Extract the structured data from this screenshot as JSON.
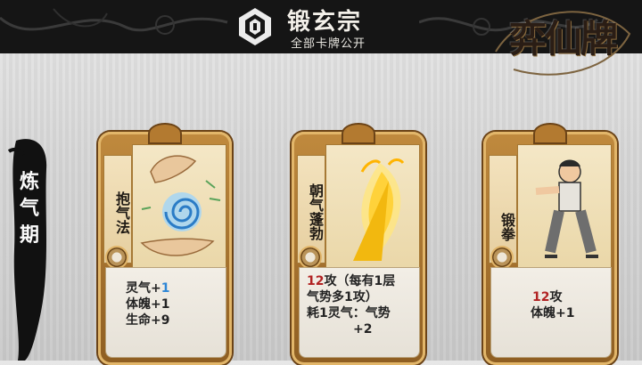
{
  "header": {
    "sect_name": "锻玄宗",
    "subtitle": "全部卡牌公开",
    "emblem_icon": "sect-emblem-icon"
  },
  "game_logo": {
    "text": "弈仙牌"
  },
  "realm": {
    "label": "炼气期"
  },
  "cards": [
    {
      "name": "抱气法",
      "art_icon": "spiral-qi-hands-icon",
      "lines": [
        {
          "parts": [
            {
              "text": "灵气+",
              "style": "plain"
            },
            {
              "text": "1",
              "style": "blue"
            }
          ]
        },
        {
          "parts": [
            {
              "text": "体魄+1",
              "style": "plain"
            }
          ]
        },
        {
          "parts": [
            {
              "text": "生命+9",
              "style": "plain"
            }
          ]
        }
      ]
    },
    {
      "name": "朝气蓬勃",
      "art_icon": "golden-flame-icon",
      "lines": [
        {
          "parts": [
            {
              "text": "12",
              "style": "red"
            },
            {
              "text": "攻（每有1层",
              "style": "plain"
            }
          ]
        },
        {
          "parts": [
            {
              "text": "气势多1攻）",
              "style": "plain"
            }
          ]
        },
        {
          "parts": [
            {
              "text": "耗1灵气：气势",
              "style": "plain"
            }
          ]
        },
        {
          "parts": [
            {
              "text": "+2",
              "style": "plain"
            }
          ]
        }
      ]
    },
    {
      "name": "锻拳",
      "art_icon": "martial-artist-punch-icon",
      "lines": [
        {
          "parts": [
            {
              "text": "12",
              "style": "red"
            },
            {
              "text": "攻",
              "style": "plain"
            }
          ]
        },
        {
          "parts": [
            {
              "text": "体魄+1",
              "style": "plain"
            }
          ]
        }
      ]
    }
  ],
  "colors": {
    "header_bg": "#151515",
    "card_gold": "#c08a3e",
    "number_red": "#b12222",
    "number_blue": "#2d86d6"
  }
}
